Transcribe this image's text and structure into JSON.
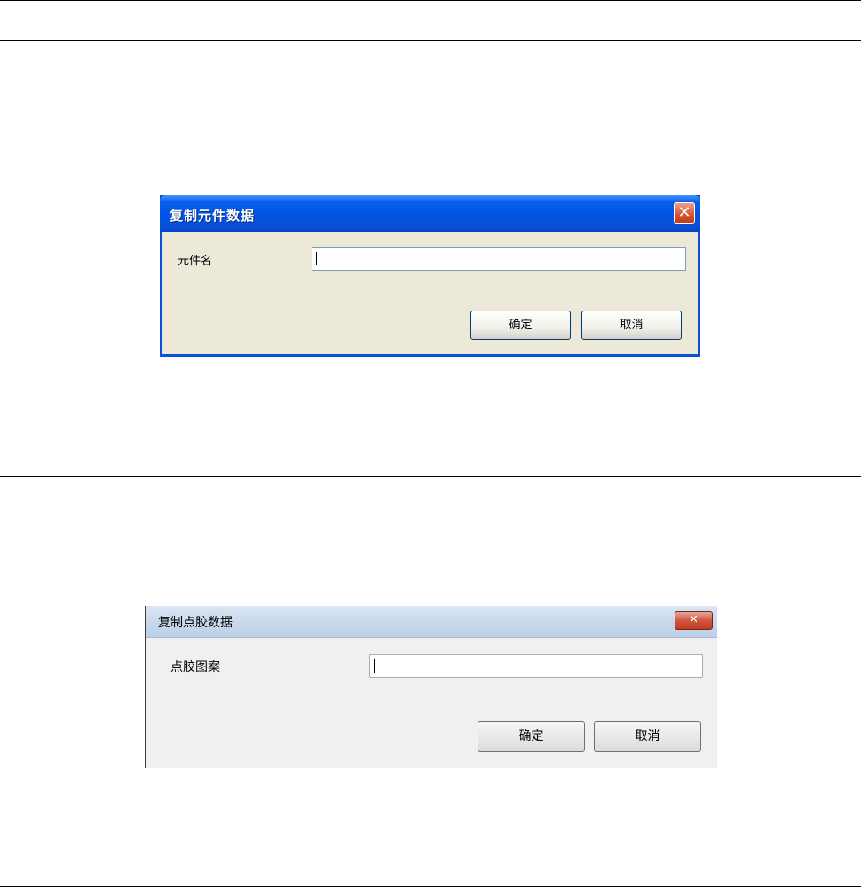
{
  "dialog1": {
    "title": "复制元件数据",
    "close_glyph": "✕",
    "field_label": "元件名",
    "field_value": "",
    "ok_label": "确定",
    "cancel_label": "取消"
  },
  "dialog2": {
    "title": "复制点胶数据",
    "close_glyph": "✕",
    "field_label": "点胶图案",
    "field_value": "",
    "ok_label": "确定",
    "cancel_label": "取消"
  }
}
